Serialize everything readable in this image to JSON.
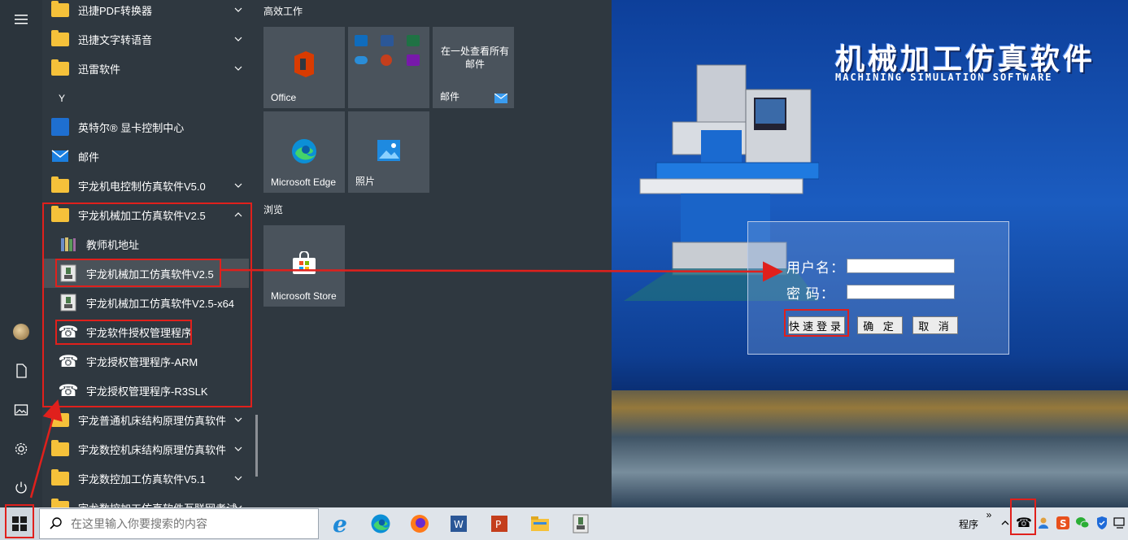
{
  "app_list": {
    "items": [
      {
        "label": "迅捷PDF转换器",
        "icon": "folder-icon",
        "chevron": "down"
      },
      {
        "label": "迅捷文字转语音",
        "icon": "folder-icon",
        "chevron": "down"
      },
      {
        "label": "迅雷软件",
        "icon": "folder-icon",
        "chevron": "down"
      },
      {
        "label": "英特尔® 显卡控制中心",
        "icon": "intel-graphics-icon"
      },
      {
        "label": "邮件",
        "icon": "mail-icon"
      },
      {
        "label": "宇龙机电控制仿真软件V5.0",
        "icon": "folder-icon",
        "chevron": "down"
      },
      {
        "label": "宇龙机械加工仿真软件V2.5",
        "icon": "folder-icon",
        "chevron": "up"
      },
      {
        "label": "教师机地址",
        "icon": "books-icon"
      },
      {
        "label": "宇龙机械加工仿真软件V2.5",
        "icon": "yulong-app-icon"
      },
      {
        "label": "宇龙机械加工仿真软件V2.5-x64",
        "icon": "yulong-app-icon"
      },
      {
        "label": "宇龙软件授权管理程序",
        "icon": "telephone-icon"
      },
      {
        "label": "宇龙授权管理程序-ARM",
        "icon": "telephone-icon"
      },
      {
        "label": "宇龙授权管理程序-R3SLK",
        "icon": "telephone-icon"
      },
      {
        "label": "宇龙普通机床结构原理仿真软件",
        "icon": "folder-icon",
        "chevron": "down"
      },
      {
        "label": "宇龙数控机床结构原理仿真软件",
        "icon": "folder-icon",
        "chevron": "down"
      },
      {
        "label": "宇龙数控加工仿真软件V5.1",
        "icon": "folder-icon",
        "chevron": "down"
      },
      {
        "label": "宇龙数控加工仿真软件互联网考试",
        "icon": "folder-icon",
        "chevron": "down"
      }
    ],
    "letter_y": "Y"
  },
  "tiles": {
    "group1_title": "高效工作",
    "group2_title": "浏览",
    "office": "Office",
    "mail_tile_text": "在一处查看所有邮件",
    "mail_tile_label": "邮件",
    "edge": "Microsoft Edge",
    "photos": "照片",
    "store": "Microsoft Store"
  },
  "sim": {
    "title": "机械加工仿真软件",
    "subtitle": "MACHINING SIMULATION SOFTWARE",
    "username_label": "用户名：",
    "password_label": "密  码：",
    "username_value": "",
    "password_value": "",
    "quick_login": "快速登录",
    "ok": "确 定",
    "cancel": "取 消"
  },
  "taskbar": {
    "search_placeholder": "在这里输入你要搜索的内容",
    "tray_label": "程序",
    "tray_more": "»"
  },
  "colors": {
    "accent_red": "#e0201c",
    "folder": "#f5c13a",
    "start_bg": "#2f3840"
  }
}
